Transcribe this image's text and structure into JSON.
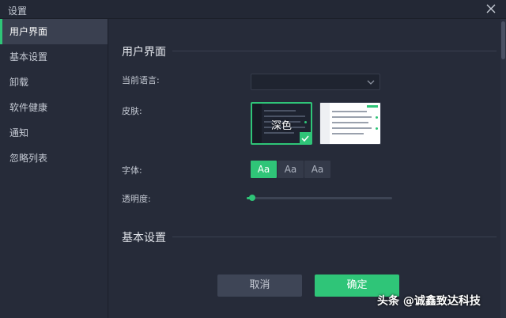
{
  "window": {
    "title": "设置",
    "close_icon": "close-icon"
  },
  "sidebar": {
    "items": [
      {
        "label": "用户界面",
        "active": true
      },
      {
        "label": "基本设置",
        "active": false
      },
      {
        "label": "卸载",
        "active": false
      },
      {
        "label": "软件健康",
        "active": false
      },
      {
        "label": "通知",
        "active": false
      },
      {
        "label": "忽略列表",
        "active": false
      }
    ]
  },
  "main": {
    "section_ui": "用户界面",
    "language_label": "当前语言:",
    "language_value": "",
    "skin_label": "皮肤:",
    "skins": [
      {
        "name": "深色",
        "selected": true
      },
      {
        "name": "",
        "selected": false
      }
    ],
    "font_label": "字体:",
    "font_options": [
      "Aa",
      "Aa",
      "Aa"
    ],
    "font_selected_index": 0,
    "opacity_label": "透明度:",
    "opacity_value": 0.04,
    "section_basic": "基本设置"
  },
  "footer": {
    "cancel_label": "取消",
    "ok_label": "确定"
  },
  "watermark": "头条 @诚鑫致达科技",
  "colors": {
    "accent": "#2fc578",
    "background": "#262b39",
    "sidebar_active": "#3a4050"
  }
}
